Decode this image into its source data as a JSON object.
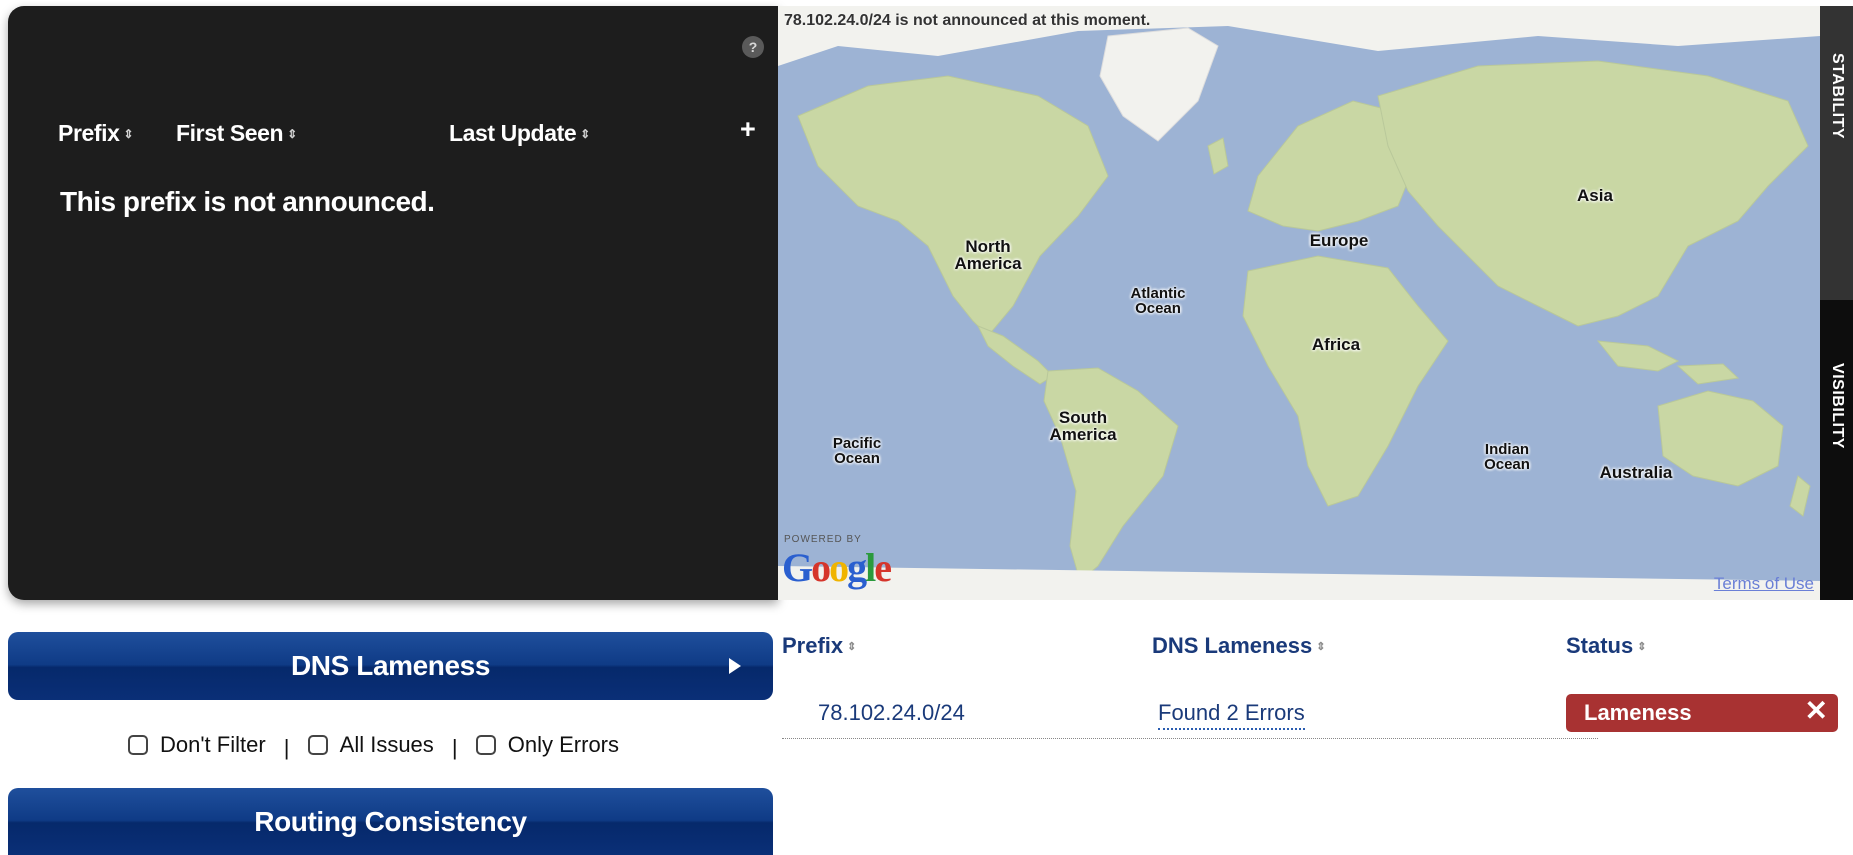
{
  "prefix_panel": {
    "columns": [
      {
        "label": "Prefix"
      },
      {
        "label": "First Seen"
      },
      {
        "label": "Last Update"
      }
    ],
    "sort_glyph": "⇕",
    "help_glyph": "?",
    "add_glyph": "+",
    "empty_message": "This prefix is not announced."
  },
  "map": {
    "status_text": "78.102.24.0/24 is not announced at this moment.",
    "continents": [
      "North America",
      "South America",
      "Europe",
      "Africa",
      "Asia",
      "Australia"
    ],
    "oceans": [
      "Atlantic Ocean",
      "Pacific Ocean",
      "Indian Ocean"
    ],
    "powered_by": "POWERED BY",
    "logo_text": "Google",
    "terms_link": "Terms of Use"
  },
  "side_tabs": {
    "stability": "STABILITY",
    "visibility": "VISIBILITY"
  },
  "sections": {
    "dns_title": "DNS Lameness",
    "routing_title": "Routing Consistency"
  },
  "filters": {
    "options": [
      "Don't Filter",
      "All Issues",
      "Only Errors"
    ],
    "separator": "|"
  },
  "lameness_table": {
    "headers": [
      "Prefix",
      "DNS Lameness",
      "Status"
    ],
    "rows": [
      {
        "prefix": "78.102.24.0/24",
        "detail": "Found 2 Errors",
        "status": "Lameness"
      }
    ]
  },
  "colors": {
    "panel_bg": "#1d1d1d",
    "bar_blue": "#0f3b86",
    "status_red": "#a83232",
    "link_blue": "#1a3a7a"
  }
}
